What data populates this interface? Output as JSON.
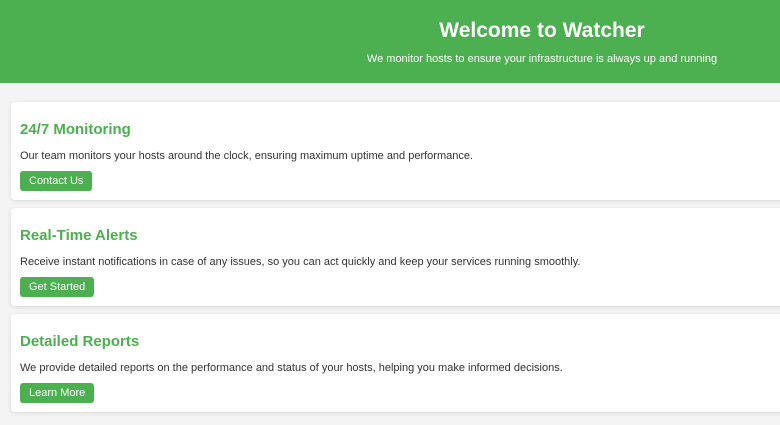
{
  "header": {
    "title": "Welcome to Watcher",
    "subtitle": "We monitor hosts to ensure your infrastructure is always up and running"
  },
  "features": [
    {
      "title": "24/7 Monitoring",
      "text": "Our team monitors your hosts around the clock, ensuring maximum uptime and performance.",
      "button": "Contact Us"
    },
    {
      "title": "Real-Time Alerts",
      "text": "Receive instant notifications in case of any issues, so you can act quickly and keep your services running smoothly.",
      "button": "Get Started"
    },
    {
      "title": "Detailed Reports",
      "text": "We provide detailed reports on the performance and status of your hosts, helping you make informed decisions.",
      "button": "Learn More"
    }
  ],
  "colors": {
    "brand_green": "#4caf50",
    "background": "#f4f4f4",
    "card": "#ffffff",
    "text": "#333333"
  }
}
